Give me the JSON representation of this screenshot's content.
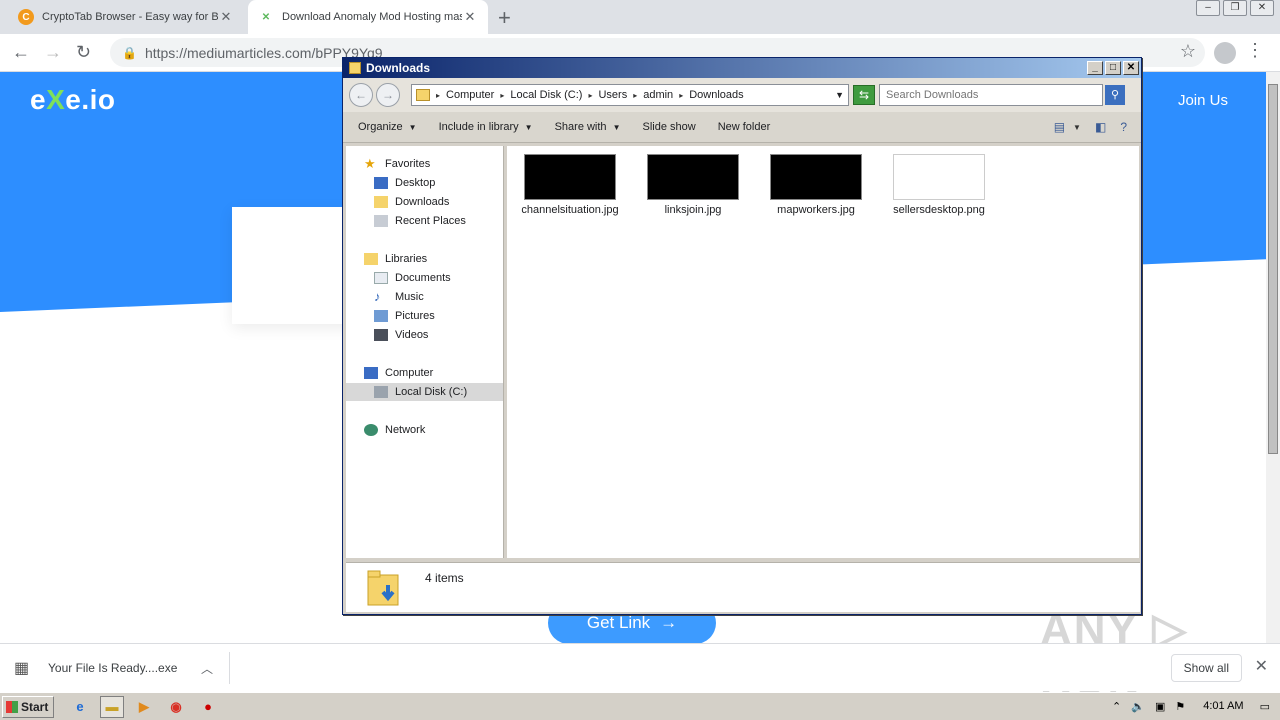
{
  "browser": {
    "tabs": [
      {
        "title": "CryptoTab Browser - Easy way for B",
        "icon": "cryptotab-icon",
        "active": false
      },
      {
        "title": "Download Anomaly Mod Hosting mas",
        "icon": "exeio-icon",
        "active": true
      }
    ],
    "address": "https://mediumarticles.com/bPPY9Yq9"
  },
  "page": {
    "logo_prefix": "e",
    "logo_x": "X",
    "logo_suffix": "e.io",
    "join_label": "Join Us",
    "get_link_label": "Get Link",
    "get_link_arrow": "→",
    "watermark": "ANY ▷ RUN"
  },
  "download_shelf": {
    "filename": "Your File Is Ready....exe",
    "show_all": "Show all"
  },
  "explorer": {
    "title": "Downloads",
    "breadcrumbs": [
      "Computer",
      "Local Disk (C:)",
      "Users",
      "admin",
      "Downloads"
    ],
    "search_placeholder": "Search Downloads",
    "commands": [
      "Organize",
      "Include in library",
      "Share with",
      "Slide show",
      "New folder"
    ],
    "nav": {
      "favorites": "Favorites",
      "desktop": "Desktop",
      "downloads": "Downloads",
      "recent": "Recent Places",
      "libraries": "Libraries",
      "documents": "Documents",
      "music": "Music",
      "pictures": "Pictures",
      "videos": "Videos",
      "computer": "Computer",
      "local_disk": "Local Disk (C:)",
      "network": "Network"
    },
    "files": [
      {
        "name": "channelsituation.jpg",
        "thumb": "dark"
      },
      {
        "name": "linksjoin.jpg",
        "thumb": "dark"
      },
      {
        "name": "mapworkers.jpg",
        "thumb": "dark"
      },
      {
        "name": "sellersdesktop.png",
        "thumb": "light"
      }
    ],
    "status": "4 items"
  },
  "taskbar": {
    "start_label": "Start",
    "clock": "4:01 AM"
  },
  "colors": {
    "hero_blue": "#2d8eff",
    "button_blue": "#3d9bff",
    "logo_green": "#7ee05a",
    "titlebar": "#0a246a"
  }
}
